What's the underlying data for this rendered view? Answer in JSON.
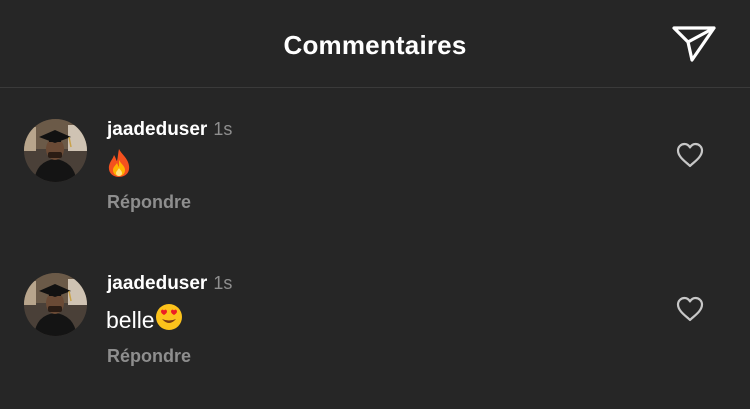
{
  "header": {
    "title": "Commentaires",
    "send_icon": "send-icon"
  },
  "comments": [
    {
      "username": "jaadeduser",
      "time": "1s",
      "text": "",
      "emoji": "fire-emoji",
      "reply_label": "Répondre",
      "like_icon": "heart-outline-icon"
    },
    {
      "username": "jaadeduser",
      "time": "1s",
      "text": "belle",
      "emoji": "heart-eyes-emoji",
      "reply_label": "Répondre",
      "like_icon": "heart-outline-icon"
    }
  ],
  "colors": {
    "background": "#262626",
    "primary_text": "#ffffff",
    "secondary_text": "#8e8e8e",
    "divider": "#3a3a3a"
  }
}
